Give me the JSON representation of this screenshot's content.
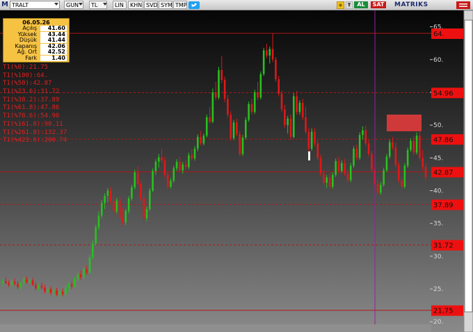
{
  "toolbar": {
    "logo": "M",
    "symbol": "TRALT",
    "period": "GUN",
    "currency": "TL",
    "scale": "LIN",
    "buttons": [
      "KHN",
      "SVD",
      "SYM",
      "TMP"
    ],
    "al_label": "AL",
    "sat_label": "SAT",
    "brand": "MATRIKS"
  },
  "info_panel": {
    "date": "06.05.26",
    "rows": [
      {
        "label": "Açılış",
        "value": "41.60"
      },
      {
        "label": "Yüksek",
        "value": "43.44"
      },
      {
        "label": "Düşük",
        "value": "41.44"
      },
      {
        "label": "Kapanış",
        "value": "42.06"
      },
      {
        "label": "Ağ. Ort",
        "value": "42.52"
      },
      {
        "label": "Fark",
        "value": "1.40"
      }
    ]
  },
  "fib_levels": [
    {
      "label": "T1(%0):21.75",
      "value": 21.75
    },
    {
      "label": "T1(%100):64.",
      "value": 64.0
    },
    {
      "label": "T1(%50):42.87",
      "value": 42.87
    },
    {
      "label": "T1(%23.6):31.72",
      "value": 31.72
    },
    {
      "label": "T1(%38.2):37.89",
      "value": 37.89
    },
    {
      "label": "T1(%61.8):47.86",
      "value": 47.86
    },
    {
      "label": "T1(%78.6):54.96",
      "value": 54.96
    },
    {
      "label": "T1(%161.8):90.11",
      "value": 90.11
    },
    {
      "label": "T1(%261.8):132.37",
      "value": 132.37
    },
    {
      "label": "T1(%423.6):200.74",
      "value": 200.74
    }
  ],
  "price_tags": [
    {
      "text": "64.",
      "value": 64.0
    },
    {
      "text": "54.96",
      "value": 54.96
    },
    {
      "text": "47.86",
      "value": 47.86
    },
    {
      "text": "42.87",
      "value": 42.87
    },
    {
      "text": "37.89",
      "value": 37.89
    },
    {
      "text": "31.72",
      "value": 31.72
    },
    {
      "text": "21.75",
      "value": 21.75
    }
  ],
  "colors": {
    "up": "#27c21f",
    "down": "#e01818",
    "fib_line": "#b01818",
    "tag_bg": "#ee1010",
    "selection_line": "#9a1e9a"
  },
  "chart_data": {
    "type": "candlestick",
    "ylim": [
      19.6,
      67.5
    ],
    "y_ticks": [
      20,
      25,
      30,
      35,
      40,
      45,
      50,
      55,
      60,
      65
    ],
    "solid_levels": [
      21.75,
      42.87,
      64.0
    ],
    "dashed_levels": [
      31.72,
      37.89,
      47.86,
      54.96
    ],
    "candles": [
      [
        26.0,
        26.5,
        25.4,
        26.2
      ],
      [
        26.2,
        26.8,
        25.8,
        25.9
      ],
      [
        25.9,
        26.3,
        25.3,
        25.6
      ],
      [
        25.6,
        26.4,
        25.2,
        26.1
      ],
      [
        26.1,
        26.6,
        25.5,
        25.8
      ],
      [
        25.8,
        26.2,
        25.0,
        25.3
      ],
      [
        25.3,
        26.1,
        24.9,
        25.9
      ],
      [
        25.9,
        26.8,
        25.6,
        26.5
      ],
      [
        26.5,
        26.9,
        25.8,
        26.0
      ],
      [
        26.0,
        26.6,
        25.7,
        26.3
      ],
      [
        26.3,
        26.7,
        25.5,
        25.6
      ],
      [
        25.6,
        26.0,
        24.8,
        25.1
      ],
      [
        25.1,
        25.8,
        24.7,
        25.5
      ],
      [
        25.5,
        26.0,
        24.9,
        25.2
      ],
      [
        25.2,
        25.7,
        24.3,
        24.6
      ],
      [
        24.6,
        25.3,
        24.2,
        25.0
      ],
      [
        25.0,
        25.4,
        24.1,
        24.4
      ],
      [
        24.4,
        25.0,
        23.7,
        24.8
      ],
      [
        24.8,
        25.2,
        23.9,
        24.1
      ],
      [
        24.1,
        24.9,
        23.6,
        24.6
      ],
      [
        24.6,
        25.1,
        23.9,
        24.2
      ],
      [
        24.2,
        25.6,
        24.0,
        25.2
      ],
      [
        25.2,
        26.0,
        24.7,
        25.7
      ],
      [
        25.7,
        26.2,
        25.0,
        25.4
      ],
      [
        25.4,
        26.8,
        25.2,
        26.5
      ],
      [
        26.5,
        27.6,
        26.1,
        27.2
      ],
      [
        27.2,
        27.8,
        26.4,
        26.8
      ],
      [
        26.8,
        28.3,
        26.5,
        28.0
      ],
      [
        28.0,
        28.6,
        27.2,
        27.5
      ],
      [
        27.5,
        30.2,
        27.3,
        29.8
      ],
      [
        29.8,
        32.4,
        29.5,
        31.9
      ],
      [
        31.9,
        34.8,
        31.6,
        34.4
      ],
      [
        34.4,
        36.8,
        34.0,
        36.2
      ],
      [
        36.2,
        38.6,
        35.8,
        38.1
      ],
      [
        38.1,
        39.6,
        37.2,
        39.2
      ],
      [
        39.2,
        40.4,
        38.3,
        40.0
      ],
      [
        40.0,
        40.6,
        38.0,
        38.4
      ],
      [
        38.4,
        39.2,
        36.2,
        36.8
      ],
      [
        36.8,
        38.9,
        36.5,
        38.5
      ],
      [
        38.5,
        39.0,
        35.6,
        35.9
      ],
      [
        35.9,
        37.4,
        34.8,
        35.2
      ],
      [
        35.2,
        37.2,
        34.8,
        36.9
      ],
      [
        36.9,
        39.2,
        36.5,
        38.8
      ],
      [
        38.8,
        40.9,
        38.5,
        40.5
      ],
      [
        40.5,
        43.2,
        40.2,
        42.8
      ],
      [
        42.8,
        43.8,
        40.6,
        41.0
      ],
      [
        41.0,
        41.5,
        38.4,
        38.8
      ],
      [
        38.8,
        39.5,
        35.2,
        35.8
      ],
      [
        35.8,
        37.6,
        35.3,
        37.2
      ],
      [
        37.2,
        40.4,
        36.9,
        40.0
      ],
      [
        40.0,
        43.4,
        39.8,
        43.0
      ],
      [
        43.0,
        44.8,
        42.4,
        44.4
      ],
      [
        44.4,
        45.6,
        43.5,
        45.1
      ],
      [
        45.1,
        46.4,
        44.2,
        44.6
      ],
      [
        44.6,
        45.2,
        42.0,
        42.4
      ],
      [
        42.4,
        42.9,
        40.2,
        40.6
      ],
      [
        40.6,
        41.9,
        40.3,
        41.5
      ],
      [
        41.5,
        43.8,
        41.2,
        43.4
      ],
      [
        43.4,
        44.8,
        43.0,
        44.4
      ],
      [
        44.4,
        45.2,
        42.8,
        43.1
      ],
      [
        43.1,
        44.4,
        42.6,
        44.0
      ],
      [
        44.0,
        44.6,
        43.2,
        43.6
      ],
      [
        43.6,
        45.8,
        43.3,
        45.4
      ],
      [
        45.4,
        46.3,
        44.6,
        44.9
      ],
      [
        44.9,
        46.8,
        44.6,
        46.4
      ],
      [
        46.4,
        48.6,
        46.0,
        48.2
      ],
      [
        48.2,
        49.1,
        46.9,
        47.2
      ],
      [
        47.2,
        48.7,
        46.9,
        48.4
      ],
      [
        48.4,
        51.6,
        48.1,
        51.2
      ],
      [
        51.2,
        52.8,
        50.2,
        50.5
      ],
      [
        50.5,
        55.6,
        50.3,
        55.0
      ],
      [
        55.0,
        56.6,
        53.8,
        54.2
      ],
      [
        54.2,
        58.9,
        53.9,
        58.4
      ],
      [
        58.4,
        60.5,
        56.4,
        56.9
      ],
      [
        56.9,
        57.4,
        53.5,
        54.0
      ],
      [
        54.0,
        54.6,
        51.2,
        51.6
      ],
      [
        51.6,
        52.1,
        47.6,
        48.0
      ],
      [
        48.0,
        50.8,
        47.7,
        50.4
      ],
      [
        50.4,
        51.0,
        48.3,
        48.6
      ],
      [
        48.6,
        49.1,
        45.2,
        45.6
      ],
      [
        45.6,
        48.5,
        45.3,
        48.1
      ],
      [
        48.1,
        51.2,
        47.8,
        50.8
      ],
      [
        50.8,
        53.6,
        50.5,
        53.2
      ],
      [
        53.2,
        54.0,
        51.6,
        52.0
      ],
      [
        52.0,
        55.4,
        51.7,
        55.0
      ],
      [
        55.0,
        56.6,
        53.8,
        54.2
      ],
      [
        54.2,
        58.2,
        53.9,
        57.8
      ],
      [
        57.8,
        61.8,
        57.5,
        61.4
      ],
      [
        61.4,
        62.4,
        60.2,
        60.6
      ],
      [
        60.6,
        62.0,
        59.4,
        61.6
      ],
      [
        61.6,
        64.0,
        59.6,
        60.0
      ],
      [
        60.0,
        60.4,
        56.6,
        57.0
      ],
      [
        57.0,
        57.5,
        54.4,
        54.8
      ],
      [
        54.8,
        55.3,
        52.0,
        52.4
      ],
      [
        52.4,
        53.1,
        49.6,
        50.0
      ],
      [
        50.0,
        51.4,
        48.7,
        51.0
      ],
      [
        51.0,
        51.6,
        47.8,
        48.2
      ],
      [
        48.2,
        54.9,
        48.0,
        54.4
      ],
      [
        54.4,
        55.2,
        51.6,
        52.0
      ],
      [
        52.0,
        53.8,
        51.6,
        53.4
      ],
      [
        53.4,
        54.0,
        50.8,
        51.2
      ],
      [
        51.2,
        52.8,
        48.6,
        49.0
      ],
      [
        49.0,
        49.6,
        46.0,
        46.4
      ],
      [
        46.4,
        49.5,
        46.1,
        49.0
      ],
      [
        49.0,
        49.6,
        46.8,
        47.2
      ],
      [
        47.2,
        47.7,
        44.6,
        45.0
      ],
      [
        45.0,
        45.5,
        42.2,
        42.6
      ],
      [
        42.6,
        43.2,
        40.8,
        41.2
      ],
      [
        41.2,
        42.4,
        40.4,
        42.0
      ],
      [
        42.0,
        42.6,
        40.2,
        40.6
      ],
      [
        40.6,
        42.8,
        40.3,
        42.4
      ],
      [
        42.4,
        44.9,
        42.1,
        44.5
      ],
      [
        44.5,
        45.2,
        42.6,
        43.0
      ],
      [
        43.0,
        44.6,
        42.7,
        44.2
      ],
      [
        44.2,
        44.8,
        42.3,
        42.6
      ],
      [
        42.6,
        43.3,
        41.2,
        41.6
      ],
      [
        41.6,
        44.2,
        41.3,
        43.8
      ],
      [
        43.8,
        46.8,
        43.5,
        46.4
      ],
      [
        46.4,
        47.0,
        44.6,
        45.0
      ],
      [
        45.0,
        48.9,
        44.7,
        48.5
      ],
      [
        48.5,
        49.8,
        47.8,
        49.2
      ],
      [
        49.2,
        49.9,
        46.8,
        47.2
      ],
      [
        47.2,
        47.8,
        45.2,
        45.6
      ],
      [
        45.6,
        46.1,
        42.8,
        43.2
      ],
      [
        43.2,
        43.8,
        40.6,
        41.0
      ],
      [
        41.0,
        41.6,
        39.3,
        39.7
      ],
      [
        39.7,
        41.3,
        39.4,
        40.9
      ],
      [
        40.9,
        43.5,
        40.6,
        43.1
      ],
      [
        43.1,
        45.6,
        42.8,
        45.2
      ],
      [
        45.2,
        47.8,
        44.9,
        47.4
      ],
      [
        47.4,
        48.2,
        46.2,
        46.6
      ],
      [
        46.6,
        47.3,
        43.5,
        43.9
      ],
      [
        43.9,
        44.4,
        41.2,
        41.6
      ],
      [
        41.6,
        42.1,
        40.2,
        40.6
      ],
      [
        40.6,
        44.2,
        40.3,
        43.8
      ],
      [
        43.8,
        46.6,
        43.5,
        46.2
      ],
      [
        46.2,
        48.0,
        45.9,
        47.6
      ],
      [
        47.6,
        48.3,
        45.4,
        45.8
      ],
      [
        45.8,
        48.9,
        45.5,
        48.4
      ],
      [
        48.4,
        49.0,
        44.6,
        45.0
      ],
      [
        45.0,
        46.2,
        43.1,
        43.6
      ],
      [
        43.6,
        44.2,
        41.6,
        42.06
      ]
    ]
  }
}
